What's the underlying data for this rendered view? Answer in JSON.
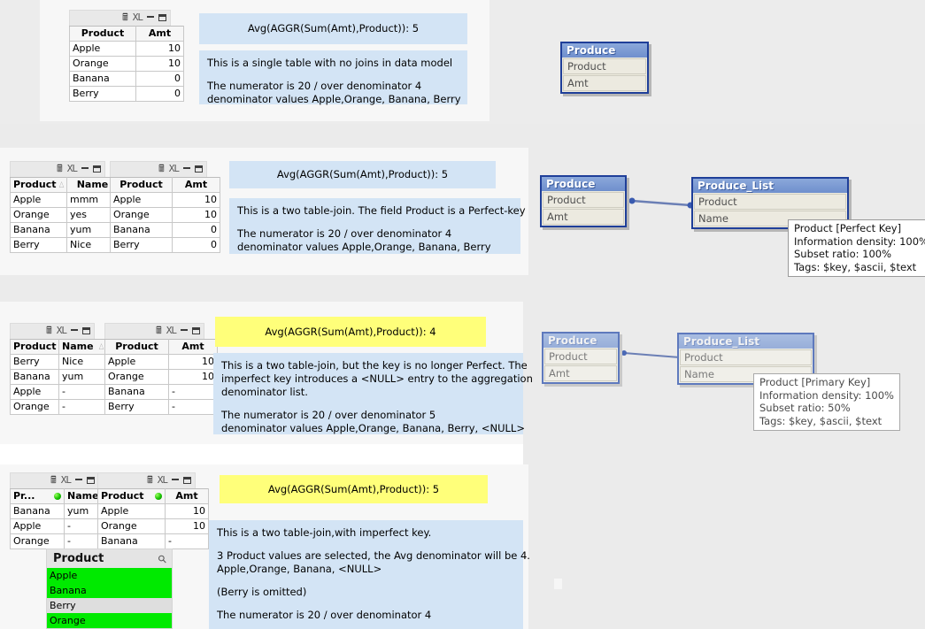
{
  "colors": {
    "page_bg": "#ebebeb",
    "band_bg": "#f7f7f7",
    "info_blue": "#d3e4f5",
    "info_yellow": "#ffff7a",
    "selected_green": "#00ea00",
    "alt_gray": "#dedede",
    "dm_title": "#6f8fcd",
    "dm_border": "#1f3f99"
  },
  "table_icons": {
    "print": "print-icon",
    "excel": "XL",
    "minimize": "minimize-icon",
    "maximize": "maximize-icon",
    "search": "search-icon"
  },
  "sections": [
    {
      "id": "section-1",
      "tables": [
        {
          "name": "produce-table",
          "columns": [
            "Product",
            "Amt"
          ],
          "rows": [
            [
              "Apple",
              "10"
            ],
            [
              "Orange",
              "10"
            ],
            [
              "Banana",
              "0"
            ],
            [
              "Berry",
              "0"
            ]
          ]
        }
      ],
      "result_box": {
        "text": "Avg(AGGR(Sum(Amt),Product)): 5",
        "style": "blue"
      },
      "info_box": {
        "style": "blue",
        "lines": [
          "This is a single table with no joins in data model",
          "",
          "The numerator is 20  / over denominator 4",
          "denominator values Apple,Orange, Banana, Berry"
        ]
      },
      "model": {
        "boxes": [
          {
            "title": "Produce",
            "fields": [
              "Product",
              "Amt"
            ],
            "dim": false
          }
        ],
        "tooltip": null
      }
    },
    {
      "id": "section-2",
      "tables": [
        {
          "name": "produce-list-table",
          "columns": [
            "Product",
            "Name"
          ],
          "sort_on": 0,
          "rows": [
            [
              "Apple",
              "mmm"
            ],
            [
              "Orange",
              "yes"
            ],
            [
              "Banana",
              "yum"
            ],
            [
              "Berry",
              "Nice"
            ]
          ]
        },
        {
          "name": "produce-table",
          "columns": [
            "Product",
            "Amt"
          ],
          "rows": [
            [
              "Apple",
              "10"
            ],
            [
              "Orange",
              "10"
            ],
            [
              "Banana",
              "0"
            ],
            [
              "Berry",
              "0"
            ]
          ]
        }
      ],
      "result_box": {
        "text": "Avg(AGGR(Sum(Amt),Product)): 5",
        "style": "blue"
      },
      "info_box": {
        "style": "blue",
        "lines": [
          "This is a two table-join.  The field Product is a Perfect-key",
          "",
          "The numerator is 20  / over denominator 4",
          "denominator values Apple,Orange, Banana, Berry"
        ]
      },
      "model": {
        "boxes": [
          {
            "title": "Produce",
            "fields": [
              "Product",
              "Amt"
            ],
            "dim": false
          },
          {
            "title": "Produce_List",
            "fields": [
              "Product",
              "Name"
            ],
            "dim": false
          }
        ],
        "tooltip": {
          "lines": [
            "Product [Perfect Key]",
            "Information density: 100%",
            "Subset ratio: 100%",
            "Tags: $key, $ascii, $text"
          ]
        }
      }
    },
    {
      "id": "section-3",
      "tables": [
        {
          "name": "produce-list-table",
          "columns": [
            "Product",
            "Name"
          ],
          "sort_on": 1,
          "rows": [
            [
              "Berry",
              "Nice"
            ],
            [
              "Banana",
              "yum"
            ],
            [
              "Apple",
              "-"
            ],
            [
              "Orange",
              "-"
            ]
          ]
        },
        {
          "name": "produce-table",
          "columns": [
            "Product",
            "Amt"
          ],
          "rows": [
            [
              "Apple",
              "10"
            ],
            [
              "Orange",
              "10"
            ],
            [
              "Banana",
              "-"
            ],
            [
              "Berry",
              "-"
            ]
          ]
        }
      ],
      "result_box": {
        "text": "Avg(AGGR(Sum(Amt),Product)): 4",
        "style": "yellow"
      },
      "info_box": {
        "style": "blue",
        "lines": [
          "This is a two table-join, but the key is no longer Perfect.  The",
          "imperfect key introduces a <NULL> entry to the aggregation",
          "denominator list.",
          "",
          "The numerator is 20  / over denominator  5",
          "denominator values Apple,Orange, Banana, Berry, <NULL>"
        ]
      },
      "model": {
        "boxes": [
          {
            "title": "Produce",
            "fields": [
              "Product",
              "Amt"
            ],
            "dim": true
          },
          {
            "title": "Produce_List",
            "fields": [
              "Product",
              "Name"
            ],
            "dim": true
          }
        ],
        "tooltip": {
          "lines": [
            "Product [Primary Key]",
            "Information density: 100%",
            "Subset ratio: 50%",
            "Tags: $key, $ascii, $text"
          ]
        }
      }
    },
    {
      "id": "section-4",
      "tables": [
        {
          "name": "produce-list-table",
          "columns": [
            "Pr...",
            "Name"
          ],
          "sort_on": 1,
          "selected_col": 0,
          "rows": [
            [
              "Banana",
              "yum"
            ],
            [
              "Apple",
              "-"
            ],
            [
              "Orange",
              "-"
            ]
          ]
        },
        {
          "name": "produce-table",
          "columns": [
            "Product",
            "Amt"
          ],
          "selected_col": 0,
          "rows": [
            [
              "Apple",
              "10"
            ],
            [
              "Orange",
              "10"
            ],
            [
              "Banana",
              "-"
            ]
          ]
        }
      ],
      "listbox": {
        "title": "Product",
        "items": [
          {
            "label": "Apple",
            "state": "selected"
          },
          {
            "label": "Banana",
            "state": "selected"
          },
          {
            "label": "Berry",
            "state": "alternate"
          },
          {
            "label": "Orange",
            "state": "selected"
          }
        ]
      },
      "result_box": {
        "text": "Avg(AGGR(Sum(Amt),Product)): 5",
        "style": "yellow"
      },
      "info_box": {
        "style": "blue",
        "lines": [
          "This is a two table-join,with imperfect key.",
          "",
          "3 Product values are selected, the Avg denominator will be 4.",
          "Apple,Orange, Banana, <NULL>",
          "",
          "(Berry is omitted)",
          "",
          "The numerator is 20  / over denominator 4"
        ]
      }
    }
  ]
}
